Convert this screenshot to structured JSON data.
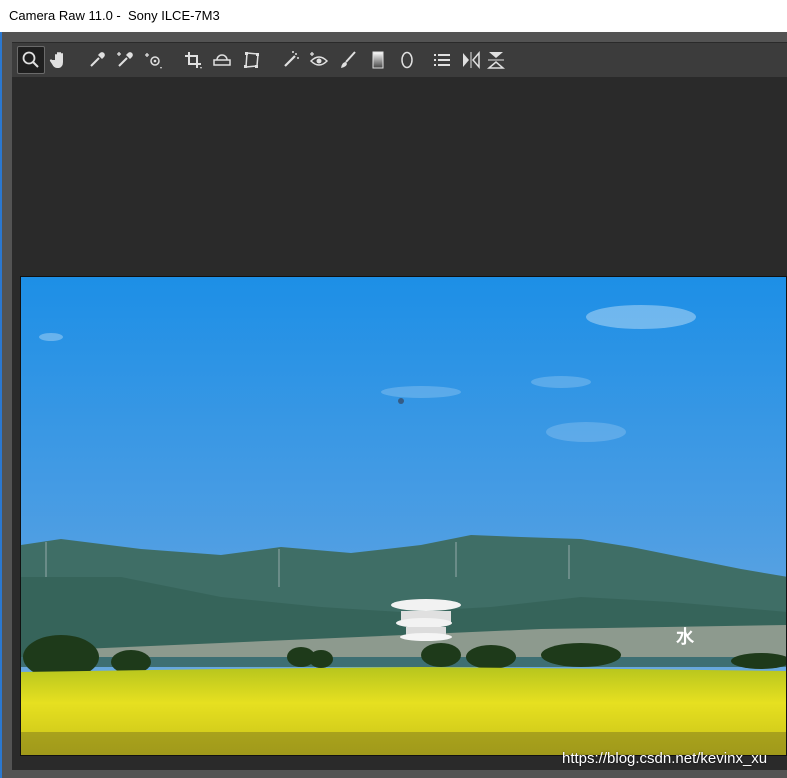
{
  "window": {
    "title": "Camera Raw 11.0 -  Sony ILCE-7M3"
  },
  "toolbar": {
    "tools": [
      {
        "icon": "zoom-icon"
      },
      {
        "icon": "hand-icon"
      },
      {
        "icon": "white-balance-icon"
      },
      {
        "icon": "color-sampler-icon"
      },
      {
        "icon": "targeted-adjustment-icon"
      },
      {
        "icon": "crop-icon"
      },
      {
        "icon": "straighten-icon"
      },
      {
        "icon": "transform-icon"
      },
      {
        "icon": "spot-removal-icon"
      },
      {
        "icon": "red-eye-icon"
      },
      {
        "icon": "adjustment-brush-icon"
      },
      {
        "icon": "graduated-filter-icon"
      },
      {
        "icon": "radial-filter-icon"
      },
      {
        "icon": "preferences-icon"
      },
      {
        "icon": "rotate-ccw-icon"
      },
      {
        "icon": "rotate-cw-icon"
      }
    ]
  },
  "photo": {
    "colors": {
      "sky_top": "#1d8fe6",
      "sky_bottom": "#6fa7da",
      "mountain": "#3f6e66",
      "field": "#e6e020"
    },
    "wall_text": "水"
  },
  "watermark": {
    "text": "https://blog.csdn.net/kevinx_xu"
  }
}
